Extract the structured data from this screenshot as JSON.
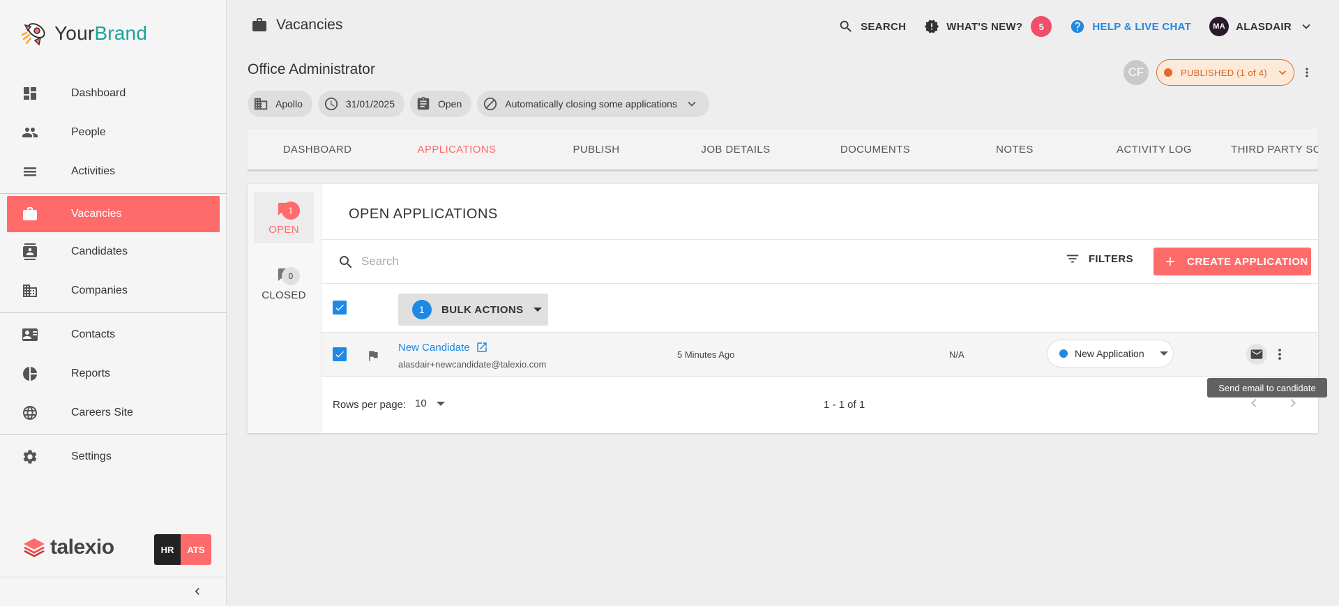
{
  "brand": {
    "part1": "Your",
    "part2": "Brand"
  },
  "sidebar": {
    "items": [
      {
        "label": "Dashboard"
      },
      {
        "label": "People"
      },
      {
        "label": "Activities"
      },
      {
        "label": "Vacancies"
      },
      {
        "label": "Candidates"
      },
      {
        "label": "Companies"
      },
      {
        "label": "Contacts"
      },
      {
        "label": "Reports"
      },
      {
        "label": "Careers Site"
      },
      {
        "label": "Settings"
      }
    ],
    "footer_logo": "talexio",
    "hr": "HR",
    "ats": "ATS"
  },
  "topbar": {
    "page_title": "Vacancies",
    "search": "SEARCH",
    "whats_new": "WHAT'S NEW?",
    "whats_new_count": "5",
    "help": "HELP & LIVE CHAT",
    "avatar": "MA",
    "user": "ALASDAIR"
  },
  "job": {
    "title": "Office Administrator",
    "company": "Apollo",
    "date": "31/01/2025",
    "state": "Open",
    "closing": "Automatically closing some applications",
    "owner_initials": "CF",
    "published": "PUBLISHED (1 of 4)"
  },
  "tabs": [
    "DASHBOARD",
    "APPLICATIONS",
    "PUBLISH",
    "JOB DETAILS",
    "DOCUMENTS",
    "NOTES",
    "ACTIVITY LOG",
    "THIRD PARTY SO"
  ],
  "side_tabs": {
    "open_label": "OPEN",
    "open_count": "1",
    "closed_label": "CLOSED",
    "closed_count": "0"
  },
  "applications": {
    "title": "OPEN APPLICATIONS",
    "search_placeholder": "Search",
    "filters": "FILTERS",
    "create": "CREATE APPLICATION",
    "bulk_count": "1",
    "bulk_actions": "BULK ACTIONS",
    "rows": [
      {
        "name": "New Candidate",
        "email": "alasdair+newcandidate@talexio.com",
        "time": "5 Minutes Ago",
        "score": "N/A",
        "status": "New Application"
      }
    ],
    "rows_per_page_label": "Rows per page:",
    "rows_per_page": "10",
    "range": "1 - 1 of 1"
  },
  "tooltip": "Send email to candidate",
  "colors": {
    "accent": "#ff6b6b",
    "link": "#1e88e5",
    "published": "#e36a2a"
  }
}
